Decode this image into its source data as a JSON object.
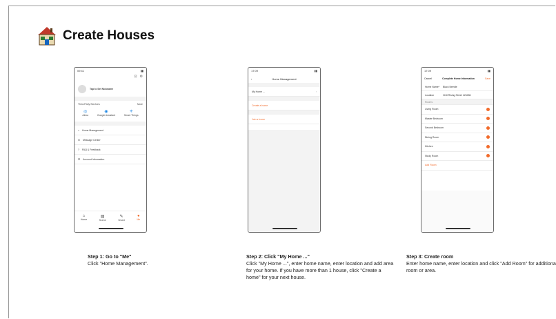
{
  "header": {
    "title": "Create Houses"
  },
  "phone1": {
    "time": "09:41",
    "profile": "Tap to Set Nickname",
    "services_title": "Third-Party Services",
    "services_more": "More",
    "services": [
      "Alexa",
      "Google Assistant",
      "Smart Things"
    ],
    "menu": [
      "Home Management",
      "Message Center",
      "FAQ & Feedback",
      "Account Information"
    ],
    "tabs": [
      "Home",
      "Scene",
      "Smart",
      "Me"
    ]
  },
  "phone2": {
    "time": "17:09",
    "title": "Home Management",
    "items": [
      "My Home ...",
      "Create a home",
      "Join a home"
    ]
  },
  "phone3": {
    "time": "17:09",
    "cancel": "Cancel",
    "title": "Complete Home Information",
    "save": "Save",
    "name_label": "Home Name*",
    "name_value": "Black Needle",
    "location_label": "Location",
    "location_value": "Chill Rising Street 123456",
    "rooms_label": "Rooms",
    "rooms": [
      "Living Room",
      "Master Bedroom",
      "Second Bedroom",
      "Dining Room",
      "Kitchen",
      "Study Room"
    ],
    "add_room": "Add Room"
  },
  "steps": [
    {
      "title": "Step 1: Go to \"Me\"",
      "body": "Click \"Home Management\"."
    },
    {
      "title": "Step 2: Click \"My Home ...\"",
      "body": "Click \"My Home ...\", enter home name, enter location and add area for your home. If you have more than 1 house, click \"Create a home\" for your next house."
    },
    {
      "title": "Step 3: Create room",
      "body": "Enter home name, enter location and click \"Add Room\" for additional room or area."
    }
  ],
  "colors": {
    "accent": "#f26b2b",
    "text": "#222222",
    "frame": "#6b6b6b"
  }
}
